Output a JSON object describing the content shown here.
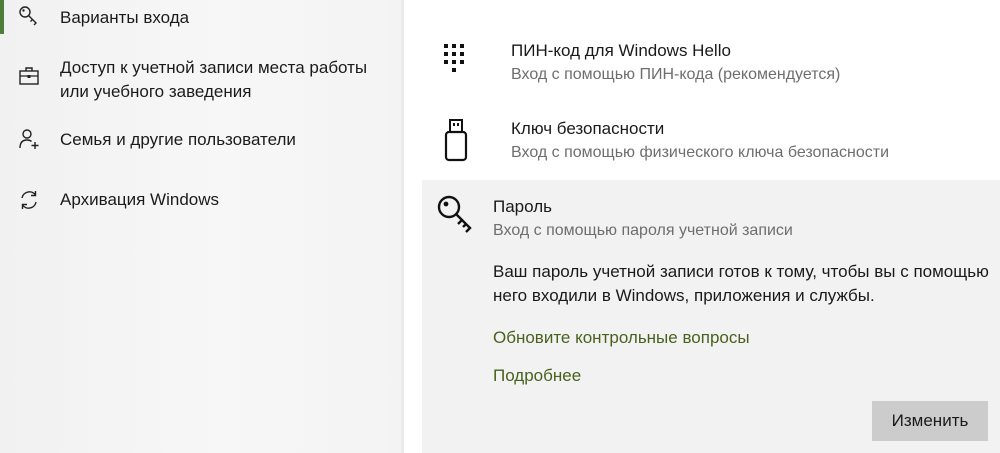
{
  "sidebar": {
    "items": [
      {
        "label": "Варианты входа",
        "icon": "key-icon",
        "selected": true
      },
      {
        "label": "Доступ к учетной записи места работы",
        "label2": "или учебного заведения",
        "icon": "briefcase-icon"
      },
      {
        "label": "Семья и другие пользователи",
        "icon": "person-add-icon"
      },
      {
        "label": "Архивация Windows",
        "icon": "sync-icon"
      }
    ],
    "accent_color": "#4e7d3b"
  },
  "options": [
    {
      "title": "ПИН-код для Windows Hello",
      "subtitle": "Вход с помощью ПИН-кода (рекомендуется)",
      "icon": "pin-keypad-icon"
    },
    {
      "title": "Ключ безопасности",
      "subtitle": "Вход с помощью физического ключа безопасности",
      "icon": "usb-key-icon"
    },
    {
      "title": "Пароль",
      "subtitle": "Вход с помощью пароля учетной записи",
      "icon": "key-icon"
    }
  ],
  "password_panel": {
    "description": "Ваш пароль учетной записи готов к тому, чтобы вы с помощью него входили в Windows, приложения и службы.",
    "link_update": "Обновите контрольные вопросы",
    "link_more": "Подробнее",
    "change_button": "Изменить",
    "link_color": "#48621d"
  }
}
